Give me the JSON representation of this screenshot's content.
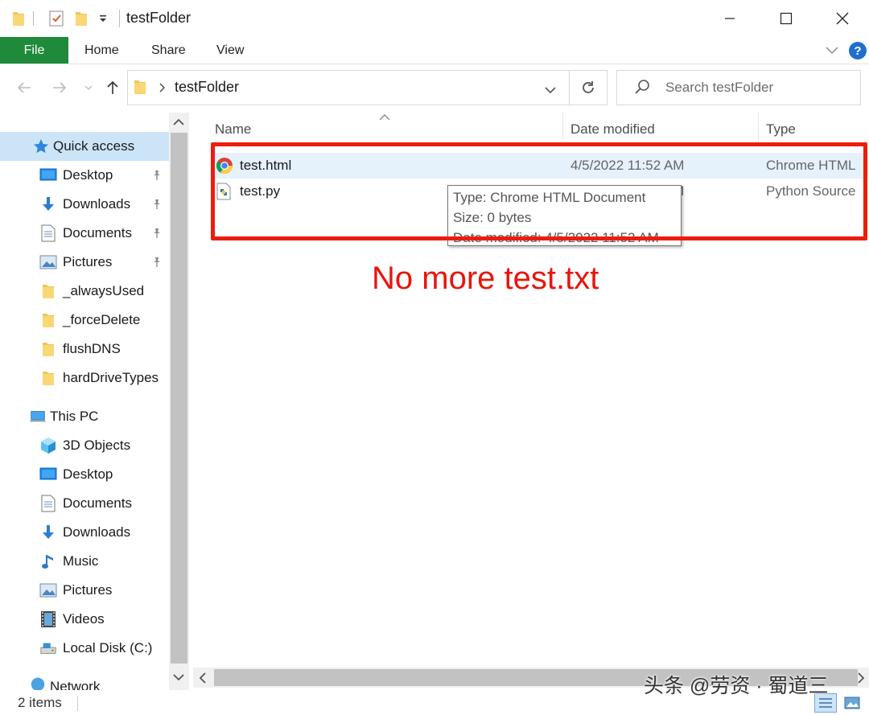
{
  "window": {
    "title": "testFolder",
    "colors": {
      "file_tab": "#1f8a3a",
      "selection": "#e5f1fb",
      "annotation": "#ee1c0d",
      "help": "#1e6fd0"
    }
  },
  "ribbon": {
    "file": "File",
    "tabs": [
      "Home",
      "Share",
      "View"
    ],
    "help": "?"
  },
  "address": {
    "path": "testFolder",
    "search_placeholder": "Search testFolder"
  },
  "nav": {
    "quick_access": "Quick access",
    "quick_items": [
      {
        "label": "Desktop",
        "icon": "desktop-icon",
        "pinned": true
      },
      {
        "label": "Downloads",
        "icon": "download-icon",
        "pinned": true
      },
      {
        "label": "Documents",
        "icon": "documents-icon",
        "pinned": true
      },
      {
        "label": "Pictures",
        "icon": "pictures-icon",
        "pinned": true
      },
      {
        "label": "_alwaysUsed",
        "icon": "folder-icon",
        "pinned": false
      },
      {
        "label": "_forceDelete",
        "icon": "folder-icon",
        "pinned": false
      },
      {
        "label": "flushDNS",
        "icon": "folder-icon",
        "pinned": false
      },
      {
        "label": "hardDriveTypes",
        "icon": "folder-icon",
        "pinned": false
      }
    ],
    "this_pc": "This PC",
    "pc_items": [
      {
        "label": "3D Objects",
        "icon": "3d-objects-icon"
      },
      {
        "label": "Desktop",
        "icon": "desktop-icon"
      },
      {
        "label": "Documents",
        "icon": "documents-icon"
      },
      {
        "label": "Downloads",
        "icon": "download-icon"
      },
      {
        "label": "Music",
        "icon": "music-icon"
      },
      {
        "label": "Pictures",
        "icon": "pictures-icon"
      },
      {
        "label": "Videos",
        "icon": "videos-icon"
      },
      {
        "label": "Local Disk (C:)",
        "icon": "local-disk-icon"
      }
    ],
    "network": "Network"
  },
  "columns": {
    "name": "Name",
    "date": "Date modified",
    "type": "Type"
  },
  "files": [
    {
      "name": "test.html",
      "date": "4/5/2022 11:52 AM",
      "type": "Chrome HTML",
      "icon": "chrome-icon",
      "selected": true
    },
    {
      "name": "test.py",
      "date": "4/5/2022 11:52 AM",
      "type": "Python Source",
      "icon": "python-file-icon",
      "selected": false
    }
  ],
  "tooltip": {
    "type": "Type: Chrome HTML Document",
    "size": "Size: 0 bytes",
    "date": "Date modified: 4/5/2022 11:52 AM"
  },
  "annotation": "No more test.txt",
  "status": "2 items",
  "watermark": "头条 @劳资 · 蜀道三"
}
